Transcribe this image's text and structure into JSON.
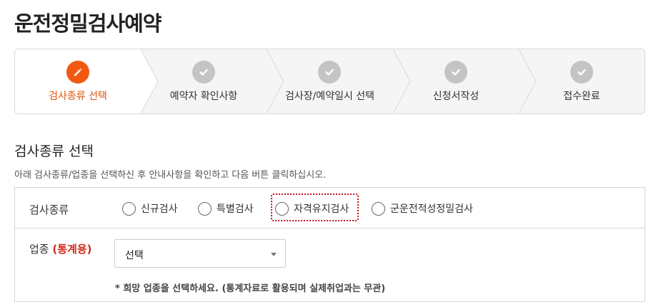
{
  "page": {
    "title": "운전정밀검사예약"
  },
  "stepper": {
    "steps": [
      {
        "label": "검사종류 선택",
        "icon": "pencil-icon",
        "state": "active"
      },
      {
        "label": "예약자 확인사항",
        "icon": "check-icon",
        "state": "pending"
      },
      {
        "label": "검사장/예약일시 선택",
        "icon": "check-icon",
        "state": "pending"
      },
      {
        "label": "신청서작성",
        "icon": "check-icon",
        "state": "pending"
      },
      {
        "label": "접수완료",
        "icon": "check-icon",
        "state": "pending"
      }
    ]
  },
  "section": {
    "title": "검사종류 선택",
    "description": "아래 검사종류/업종을 선택하신 후 안내사항을 확인하고 다음 버튼 클릭하십시오."
  },
  "form": {
    "exam_type": {
      "label": "검사종류",
      "options": [
        "신규검사",
        "특별검사",
        "자격유지검사",
        "군운전적성정밀검사"
      ],
      "selected": null,
      "focused_option": "자격유지검사"
    },
    "industry": {
      "label": "업종",
      "label_note": "(통계용)",
      "select_value": "선택",
      "note": "* 희망 업종을 선택하세요. (통계자료로 활용되며 실제취업과는 무관)"
    }
  },
  "colors": {
    "accent": "#f0590f",
    "accent_text": "#e0520c",
    "inactive_icon": "#c4c4c4",
    "focus_outline": "#c4131b",
    "label_red": "#d8261a"
  }
}
